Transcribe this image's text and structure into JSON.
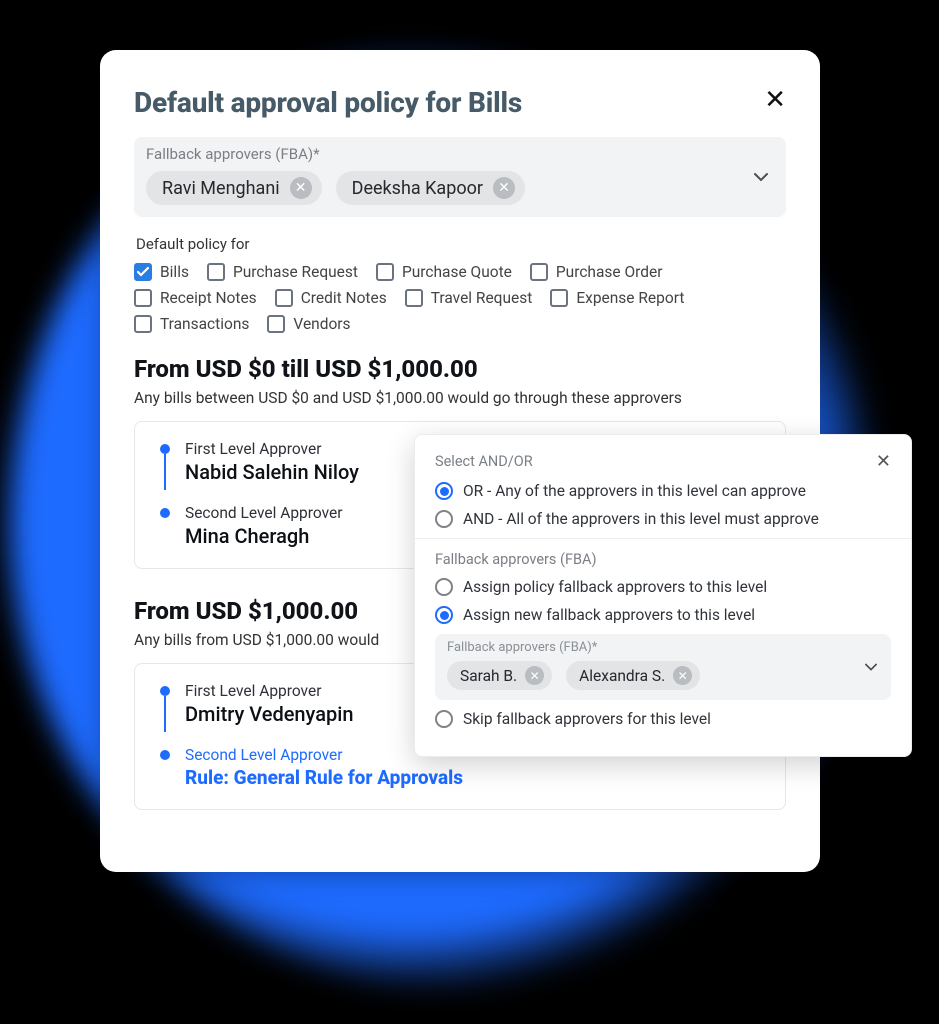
{
  "title": "Default approval policy for Bills",
  "fba_label": "Fallback approvers (FBA)*",
  "fba_chips": [
    "Ravi Menghani",
    "Deeksha Kapoor"
  ],
  "default_policy_label": "Default policy for",
  "policy_options": [
    {
      "label": "Bills",
      "checked": true
    },
    {
      "label": "Purchase Request",
      "checked": false
    },
    {
      "label": "Purchase Quote",
      "checked": false
    },
    {
      "label": "Purchase Order",
      "checked": false
    },
    {
      "label": "Receipt Notes",
      "checked": false
    },
    {
      "label": "Credit Notes",
      "checked": false
    },
    {
      "label": "Travel Request",
      "checked": false
    },
    {
      "label": "Expense Report",
      "checked": false
    },
    {
      "label": "Transactions",
      "checked": false
    },
    {
      "label": "Vendors",
      "checked": false
    }
  ],
  "ranges": [
    {
      "title": "From USD $0 till USD $1,000.00",
      "sub": "Any bills between USD $0 and USD $1,000.00 would go through these approvers",
      "levels": [
        {
          "label": "First Level Approver",
          "name": "Nabid Salehin Niloy"
        },
        {
          "label": "Second Level Approver",
          "name": "Mina Cheragh"
        }
      ]
    },
    {
      "title": "From USD $1,000.00",
      "sub": "Any bills from USD $1,000.00 would",
      "levels": [
        {
          "label": "First Level Approver",
          "name": "Dmitry Vedenyapin"
        },
        {
          "label": "Second Level Approver",
          "rule": "Rule: General Rule for Approvals"
        }
      ]
    }
  ],
  "popover": {
    "title": "Select AND/OR",
    "andor": [
      {
        "label": "OR - Any of the approvers in this level can approve",
        "selected": true
      },
      {
        "label": "AND - All of the approvers in this level must approve",
        "selected": false
      }
    ],
    "fba_section_label": "Fallback approvers (FBA)",
    "fba_options": [
      {
        "label": "Assign policy fallback approvers to this level",
        "selected": false
      },
      {
        "label": "Assign new fallback approvers to this level",
        "selected": true
      }
    ],
    "chip_label": "Fallback approvers (FBA)*",
    "chips": [
      "Sarah B.",
      "Alexandra S."
    ],
    "skip_option": {
      "label": "Skip fallback approvers for this level",
      "selected": false
    }
  }
}
